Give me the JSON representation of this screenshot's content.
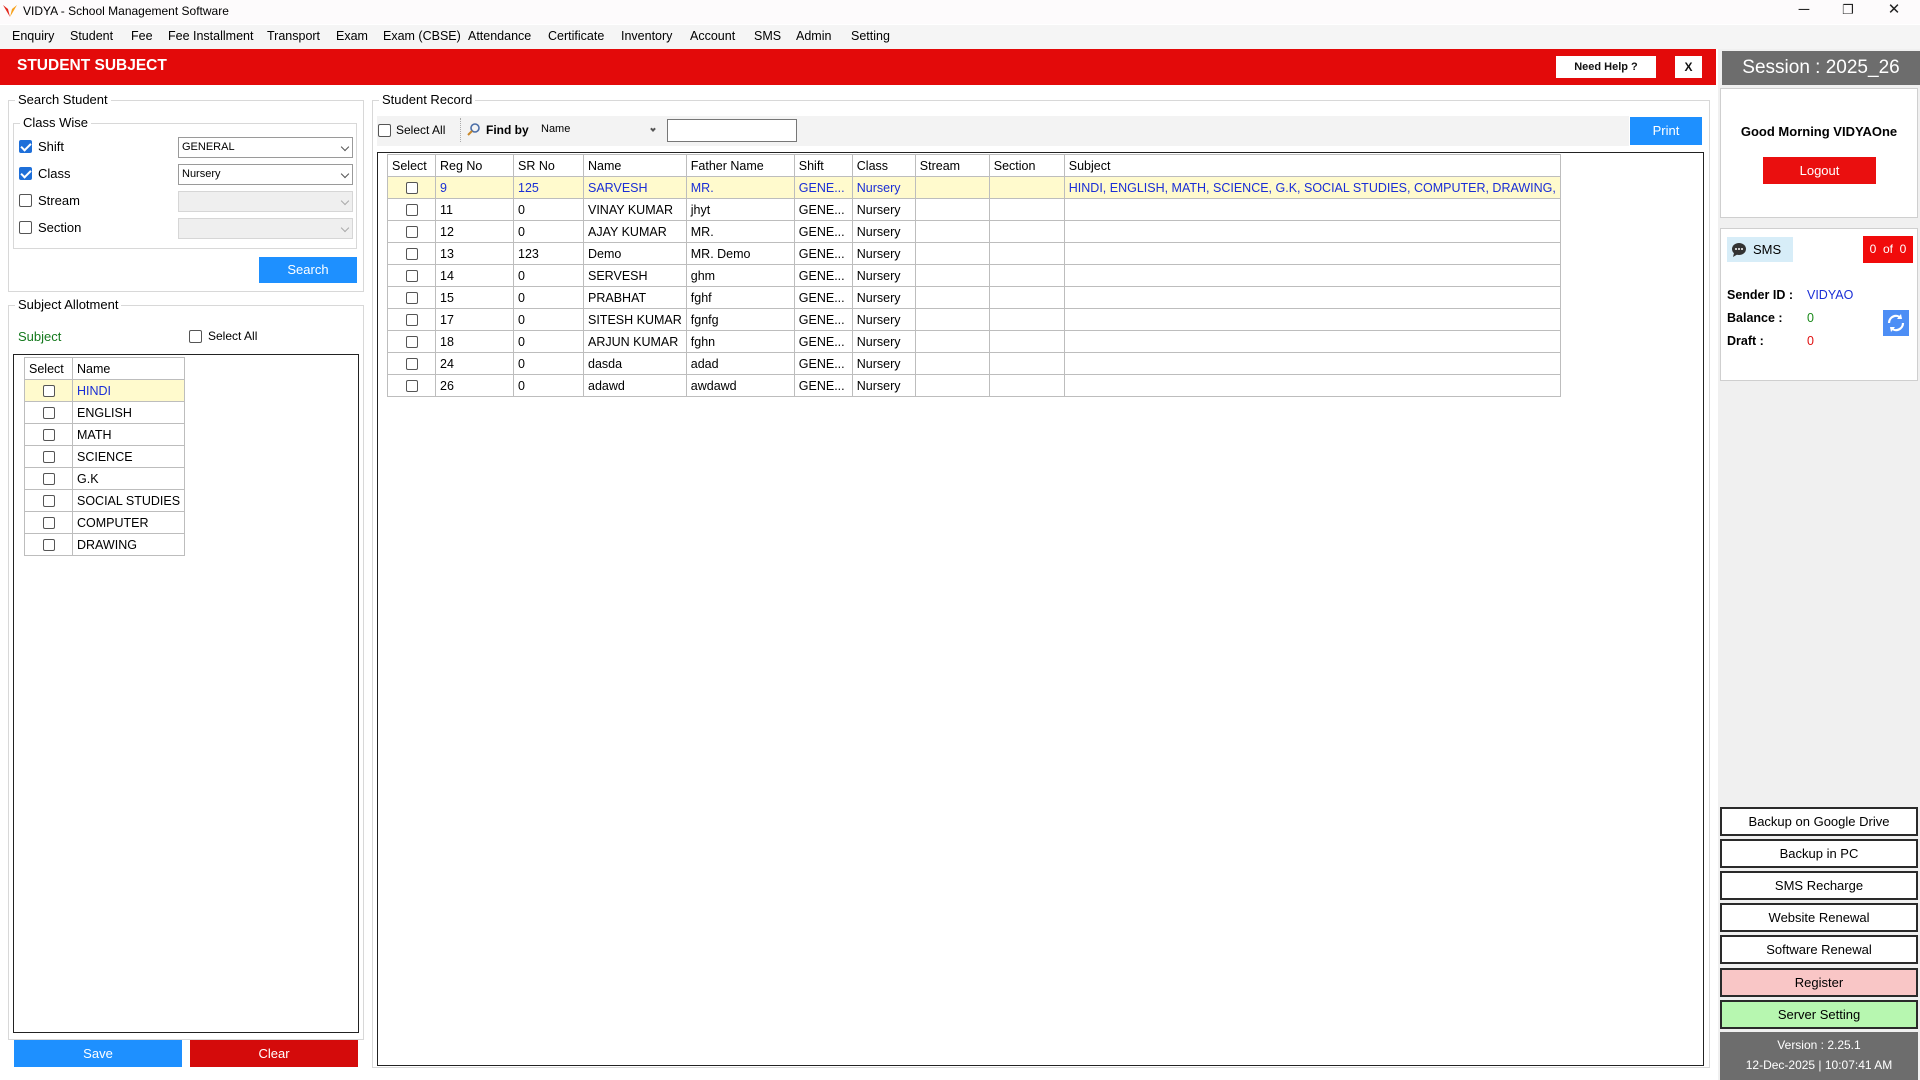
{
  "window": {
    "title": "VIDYA - School Management Software",
    "minimize": "─",
    "maximize": "❐",
    "close": "✕"
  },
  "menu": [
    "Enquiry",
    "Student",
    "Fee",
    "Fee Installment",
    "Transport",
    "Exam",
    "Exam (CBSE)",
    "Attendance",
    "Certificate",
    "Inventory",
    "Account",
    "SMS",
    "Admin",
    "Setting"
  ],
  "header": {
    "title": "STUDENT SUBJECT",
    "help_label": "Need Help ?",
    "close_label": "X"
  },
  "search_student": {
    "title": "Search Student",
    "class_wise_title": "Class Wise",
    "shift_label": "Shift",
    "shift_checked": true,
    "shift_value": "GENERAL",
    "class_label": "Class",
    "class_checked": true,
    "class_value": "Nursery",
    "stream_label": "Stream",
    "stream_checked": false,
    "stream_value": "",
    "section_label": "Section",
    "section_checked": false,
    "section_value": "",
    "search_button": "Search"
  },
  "subject_allotment": {
    "title": "Subject Allotment",
    "subject_label": "Subject",
    "select_all_label": "Select All",
    "columns": [
      "Select",
      "Name"
    ],
    "subjects": [
      "HINDI",
      "ENGLISH",
      "MATH",
      "SCIENCE",
      "G.K",
      "SOCIAL STUDIES",
      "COMPUTER",
      "DRAWING"
    ],
    "selected_index": 0,
    "save_button": "Save",
    "clear_button": "Clear"
  },
  "student_record": {
    "title": "Student Record",
    "select_all_label": "Select All",
    "find_by_label": "Find by",
    "find_by_value": "Name",
    "search_value": "",
    "print_button": "Print",
    "columns": [
      "Select",
      "Reg No",
      "SR No",
      "Name",
      "Father Name",
      "Shift",
      "Class",
      "Stream",
      "Section",
      "Subject"
    ],
    "rows": [
      [
        "9",
        "125",
        "SARVESH",
        "MR.",
        "GENE...",
        "Nursery",
        "",
        "",
        "HINDI, ENGLISH, MATH, SCIENCE, G.K, SOCIAL STUDIES, COMPUTER, DRAWING,"
      ],
      [
        "11",
        "0",
        "VINAY KUMAR",
        "jhyt",
        "GENE...",
        "Nursery",
        "",
        "",
        ""
      ],
      [
        "12",
        "0",
        "AJAY KUMAR",
        "MR.",
        "GENE...",
        "Nursery",
        "",
        "",
        ""
      ],
      [
        "13",
        "123",
        "Demo",
        "MR. Demo",
        "GENE...",
        "Nursery",
        "",
        "",
        ""
      ],
      [
        "14",
        "0",
        "SERVESH",
        "ghm",
        "GENE...",
        "Nursery",
        "",
        "",
        ""
      ],
      [
        "15",
        "0",
        "PRABHAT",
        "fghf",
        "GENE...",
        "Nursery",
        "",
        "",
        ""
      ],
      [
        "17",
        "0",
        "SITESH KUMAR",
        "fgnfg",
        "GENE...",
        "Nursery",
        "",
        "",
        ""
      ],
      [
        "18",
        "0",
        "ARJUN KUMAR",
        "fghn",
        "GENE...",
        "Nursery",
        "",
        "",
        ""
      ],
      [
        "24",
        "0",
        "dasda",
        "adad",
        "GENE...",
        "Nursery",
        "",
        "",
        ""
      ],
      [
        "26",
        "0",
        "adawd",
        "awdawd",
        "GENE...",
        "Nursery",
        "",
        "",
        ""
      ]
    ],
    "selected_index": 0
  },
  "sidebar": {
    "session": "Session : 2025_26",
    "greeting": "Good Morning VIDYAOne",
    "logout": "Logout",
    "sms_label": "SMS",
    "sms_count": "0  of  0",
    "sender_id_label": "Sender ID :",
    "sender_id": "VIDYAO",
    "balance_label": "Balance :",
    "balance": "0",
    "draft_label": "Draft :",
    "draft": "0",
    "buttons": [
      "Backup on Google Drive",
      "Backup in PC",
      "SMS Recharge",
      "Website Renewal",
      "Software Renewal",
      "Register",
      "Server Setting"
    ],
    "version": "Version : 2.25.1",
    "datetime": "12-Dec-2025 | 10:07:41 AM"
  },
  "colors": {
    "header_red": "#e30a0a",
    "accent_blue": "#1e90ff",
    "selected_row": "#fffacd",
    "register": "#f9c6c6",
    "server_setting": "#b7f7b0"
  }
}
